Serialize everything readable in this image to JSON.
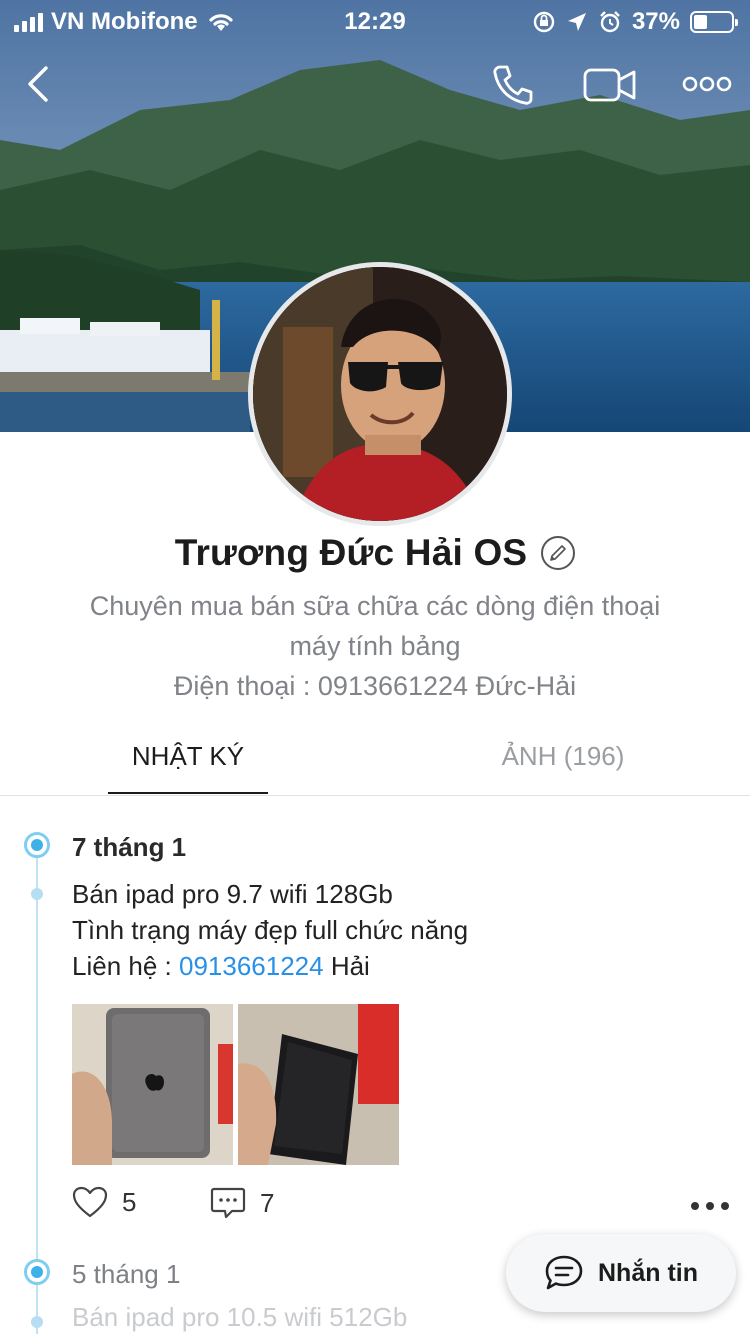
{
  "status_bar": {
    "carrier": "VN Mobifone",
    "time": "12:29",
    "battery_percent": "37%",
    "battery_level": 0.37
  },
  "profile": {
    "name": "Trương Đức Hải OS",
    "bio_line1": "Chuyên mua bán sữa chữa các dòng điện thoại",
    "bio_line2": "máy tính bảng",
    "bio_line3": "Điện thoại : 0913661224 Đức-Hải"
  },
  "tabs": [
    {
      "label": "NHẬT KÝ",
      "active": true
    },
    {
      "label": "ẢNH (196)",
      "active": false
    }
  ],
  "posts": [
    {
      "date": "7 tháng 1",
      "line1": "Bán ipad pro 9.7 wifi 128Gb",
      "line2": "Tình trạng máy đẹp full chức năng",
      "line3_prefix": "Liên hệ : ",
      "line3_phone": "0913661224",
      "line3_suffix": " Hải",
      "likes": "5",
      "comments": "7"
    },
    {
      "date": "5 tháng 1",
      "line1": "Bán ipad pro 10.5 wifi 512Gb"
    }
  ],
  "message_button": {
    "label": "Nhắn tin"
  },
  "colors": {
    "accent": "#2a8fe6",
    "timeline": "#3fb1e9",
    "muted_text": "#808388"
  }
}
